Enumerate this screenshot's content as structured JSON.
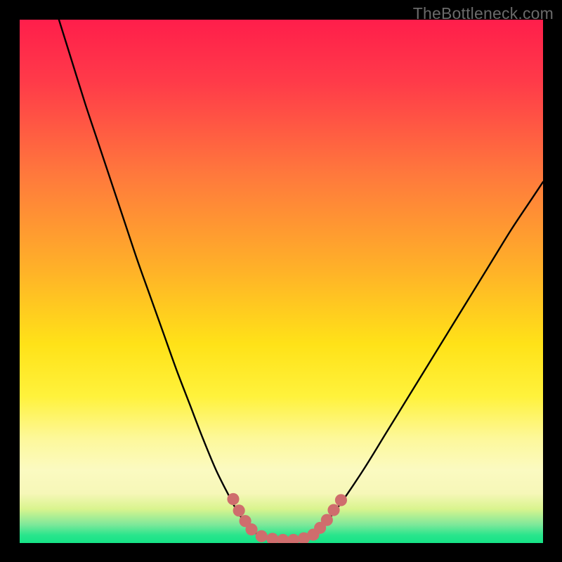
{
  "watermark": "TheBottleneck.com",
  "chart_data": {
    "type": "line",
    "title": "",
    "xlabel": "",
    "ylabel": "",
    "xlim": [
      0,
      100
    ],
    "ylim": [
      0,
      100
    ],
    "grid": false,
    "legend": false,
    "annotations": [],
    "background_gradient_stops": [
      {
        "offset": 0.0,
        "color": "#ff1e4b"
      },
      {
        "offset": 0.12,
        "color": "#ff3b49"
      },
      {
        "offset": 0.3,
        "color": "#ff7a3c"
      },
      {
        "offset": 0.48,
        "color": "#ffb228"
      },
      {
        "offset": 0.62,
        "color": "#ffe218"
      },
      {
        "offset": 0.72,
        "color": "#fff23c"
      },
      {
        "offset": 0.8,
        "color": "#fdf89a"
      },
      {
        "offset": 0.86,
        "color": "#fbfac1"
      },
      {
        "offset": 0.905,
        "color": "#f6f7b8"
      },
      {
        "offset": 0.935,
        "color": "#d9f48e"
      },
      {
        "offset": 0.965,
        "color": "#7de89a"
      },
      {
        "offset": 0.985,
        "color": "#28e58c"
      },
      {
        "offset": 1.0,
        "color": "#16e386"
      }
    ],
    "series": [
      {
        "name": "left-branch",
        "x": [
          7.5,
          10,
          12.5,
          15,
          17.5,
          20,
          22.5,
          25,
          27.5,
          30,
          32.5,
          35,
          37.5,
          40,
          41.5,
          43,
          44.5,
          46.5
        ],
        "y": [
          100,
          92,
          84,
          76.5,
          69,
          61.5,
          54,
          47,
          40,
          33,
          26.5,
          20,
          14,
          9,
          6.2,
          4,
          2.3,
          1.2
        ]
      },
      {
        "name": "valley-floor",
        "x": [
          46.5,
          48,
          50,
          52,
          54,
          55.5
        ],
        "y": [
          1.2,
          0.8,
          0.6,
          0.6,
          0.8,
          1.2
        ]
      },
      {
        "name": "right-branch",
        "x": [
          55.5,
          57,
          59,
          62,
          66,
          70,
          74,
          78,
          82,
          86,
          90,
          94,
          98,
          100
        ],
        "y": [
          1.2,
          2.3,
          4.5,
          8.5,
          14.5,
          21,
          27.5,
          34,
          40.5,
          47,
          53.5,
          60,
          66,
          69
        ]
      }
    ],
    "markers": {
      "name": "valley-markers",
      "color": "#cf6d6d",
      "radius_data_units": 1.15,
      "points": [
        {
          "x": 40.8,
          "y": 8.4
        },
        {
          "x": 41.9,
          "y": 6.2
        },
        {
          "x": 43.1,
          "y": 4.2
        },
        {
          "x": 44.3,
          "y": 2.6
        },
        {
          "x": 46.2,
          "y": 1.3
        },
        {
          "x": 48.3,
          "y": 0.8
        },
        {
          "x": 50.3,
          "y": 0.6
        },
        {
          "x": 52.3,
          "y": 0.6
        },
        {
          "x": 54.3,
          "y": 0.9
        },
        {
          "x": 56.1,
          "y": 1.6
        },
        {
          "x": 57.4,
          "y": 2.9
        },
        {
          "x": 58.7,
          "y": 4.4
        },
        {
          "x": 60.0,
          "y": 6.3
        },
        {
          "x": 61.4,
          "y": 8.2
        }
      ]
    }
  }
}
